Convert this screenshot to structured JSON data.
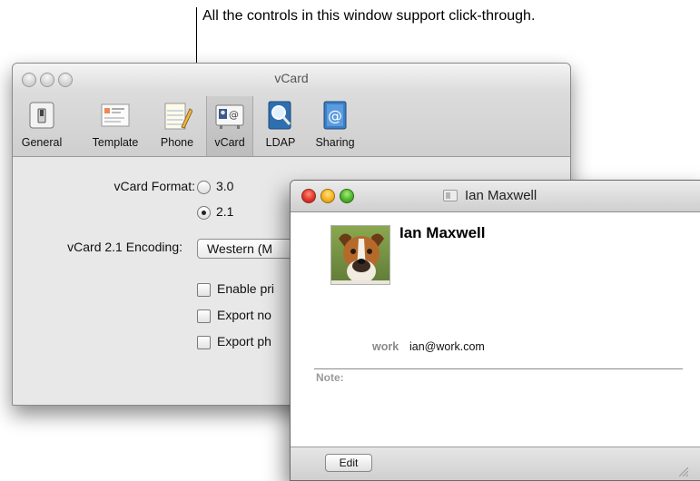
{
  "callout": {
    "text": "All the controls in this window support click-through."
  },
  "prefs_window": {
    "title": "vCard",
    "toolbar": [
      {
        "label": "General",
        "icon": "general-switch-icon"
      },
      {
        "label": "Template",
        "icon": "template-icon"
      },
      {
        "label": "Phone",
        "icon": "phone-notepad-icon"
      },
      {
        "label": "vCard",
        "icon": "vcard-icon",
        "selected": true
      },
      {
        "label": "LDAP",
        "icon": "ldap-magnifier-icon"
      },
      {
        "label": "Sharing",
        "icon": "sharing-at-icon"
      }
    ],
    "format_label": "vCard Format:",
    "format_options": [
      {
        "label": "3.0",
        "selected": false
      },
      {
        "label": "2.1",
        "selected": true
      }
    ],
    "encoding_label": "vCard 2.1 Encoding:",
    "encoding_value": "Western (M",
    "checkboxes": [
      {
        "label": "Enable pri",
        "checked": false
      },
      {
        "label": "Export no",
        "checked": false
      },
      {
        "label": "Export ph",
        "checked": false
      }
    ]
  },
  "card_window": {
    "title": "Ian Maxwell",
    "name": "Ian Maxwell",
    "email_label": "work",
    "email_value": "ian@work.com",
    "note_label": "Note:",
    "edit_button": "Edit"
  }
}
